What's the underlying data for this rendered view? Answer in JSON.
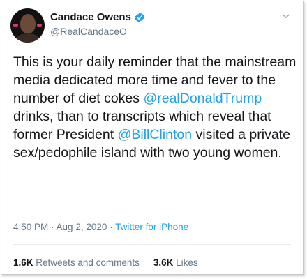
{
  "user": {
    "display_name": "Candace Owens",
    "handle": "@RealCandaceO",
    "verified": true
  },
  "icons": {
    "verified": "verified-badge-icon",
    "menu": "chevron-down-icon",
    "avatar": "profile-photo"
  },
  "tweet": {
    "text_part1": "This is your daily reminder that the mainstream media dedicated more time and fever to the number of diet cokes ",
    "mention1": "@realDonaldTrump",
    "text_part2": " drinks, than to transcripts which reveal that former President ",
    "mention2": "@BillClinton",
    "text_part3": " visited a private sex/pedophile island with two young women."
  },
  "meta": {
    "time": "4:50 PM",
    "sep1": " · ",
    "date": "Aug 2, 2020",
    "sep2": " · ",
    "source": "Twitter for iPhone"
  },
  "stats": {
    "retweets_count": "1.6K",
    "retweets_label": "Retweets and comments",
    "likes_count": "3.6K",
    "likes_label": "Likes"
  },
  "colors": {
    "link": "#1da1f2",
    "secondary_text": "#657786",
    "primary_text": "#14171a",
    "verified_badge": "#1da1f2"
  }
}
